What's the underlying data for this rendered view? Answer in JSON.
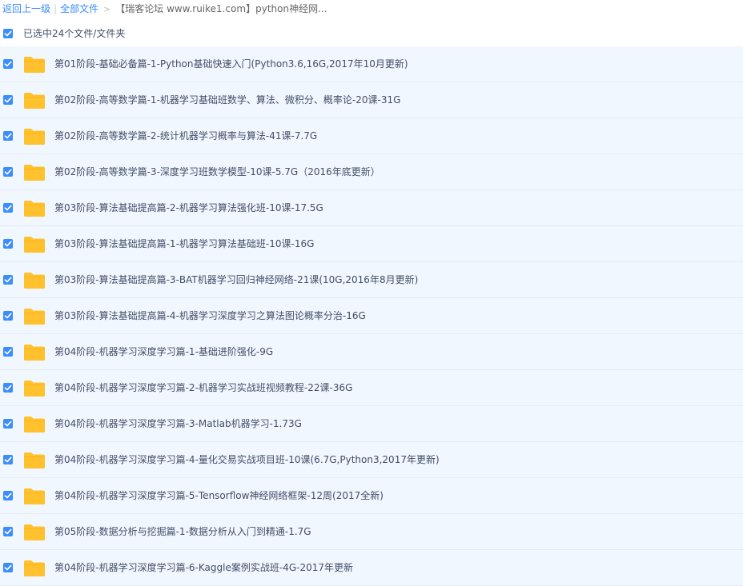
{
  "breadcrumb": {
    "back": "返回上一级",
    "separator": "|",
    "all_files": "全部文件",
    "arrow": ">",
    "current": "【瑞客论坛 www.ruike1.com】python神经网..."
  },
  "selection": {
    "label": "已选中24个文件/文件夹"
  },
  "colors": {
    "accent": "#3b8cff",
    "row_bg": "#f1f7ff",
    "folder": "#ffc12d"
  },
  "files": [
    {
      "name": "第01阶段-基础必备篇-1-Python基础快速入门(Python3.6,16G,2017年10月更新)"
    },
    {
      "name": "第02阶段-高等数学篇-1-机器学习基础班数学、算法、微积分、概率论-20课-31G"
    },
    {
      "name": "第02阶段-高等数学篇-2-统计机器学习概率与算法-41课-7.7G"
    },
    {
      "name": "第02阶段-高等数学篇-3-深度学习班数学模型-10课-5.7G（2016年底更新）"
    },
    {
      "name": "第03阶段-算法基础提高篇-2-机器学习算法强化班-10课-17.5G"
    },
    {
      "name": "第03阶段-算法基础提高篇-1-机器学习算法基础班-10课-16G"
    },
    {
      "name": "第03阶段-算法基础提高篇-3-BAT机器学习回归神经网络-21课(10G,2016年8月更新)"
    },
    {
      "name": "第03阶段-算法基础提高篇-4-机器学习深度学习之算法图论概率分治-16G"
    },
    {
      "name": "第04阶段-机器学习深度学习篇-1-基础进阶强化-9G"
    },
    {
      "name": "第04阶段-机器学习深度学习篇-2-机器学习实战班视频教程-22课-36G"
    },
    {
      "name": "第04阶段-机器学习深度学习篇-3-Matlab机器学习-1.73G"
    },
    {
      "name": "第04阶段-机器学习深度学习篇-4-量化交易实战项目班-10课(6.7G,Python3,2017年更新)"
    },
    {
      "name": "第04阶段-机器学习深度学习篇-5-Tensorflow神经网络框架-12周(2017全新)"
    },
    {
      "name": "第05阶段-数据分析与挖掘篇-1-数据分析从入门到精通-1.7G"
    },
    {
      "name": "第04阶段-机器学习深度学习篇-6-Kaggle案例实战班-4G-2017年更新"
    }
  ]
}
